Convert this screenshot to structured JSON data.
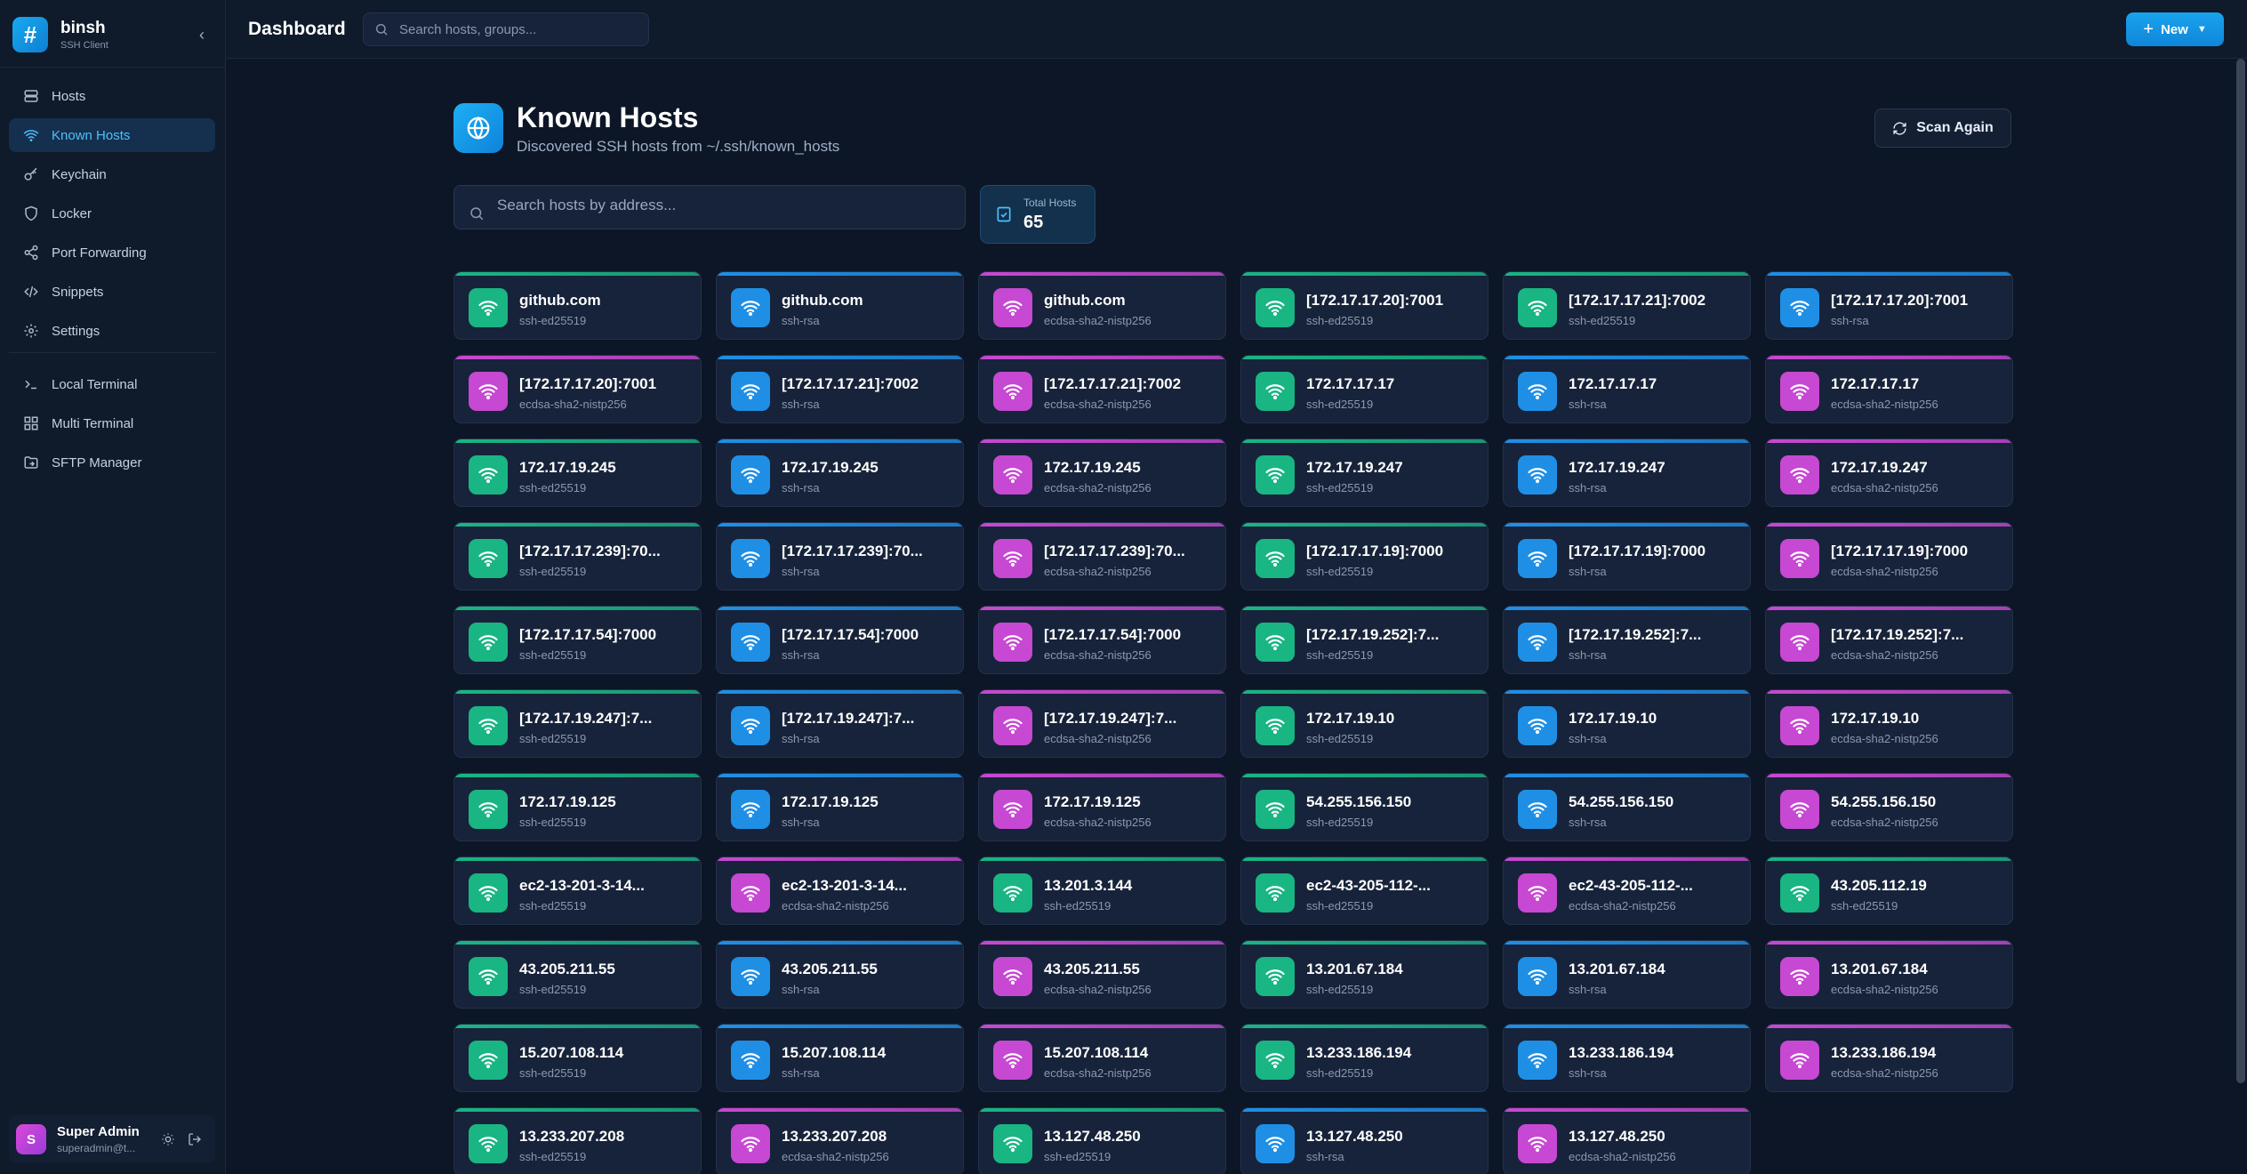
{
  "app": {
    "name": "binsh",
    "subtitle": "SSH Client"
  },
  "colors": {
    "accent": "#1ba3ee",
    "ed25519": "#19b583",
    "rsa": "#1f8fe6",
    "ecdsa": "#c748d2"
  },
  "sidebar": {
    "items": [
      {
        "label": "Hosts",
        "icon": "server-icon"
      },
      {
        "label": "Known Hosts",
        "icon": "wifi-icon",
        "active": true
      },
      {
        "label": "Keychain",
        "icon": "key-icon"
      },
      {
        "label": "Locker",
        "icon": "shield-icon"
      },
      {
        "label": "Port Forwarding",
        "icon": "share-icon"
      },
      {
        "label": "Snippets",
        "icon": "code-icon"
      },
      {
        "label": "Settings",
        "icon": "gear-icon"
      }
    ],
    "tools": [
      {
        "label": "Local Terminal",
        "icon": "terminal-icon"
      },
      {
        "label": "Multi Terminal",
        "icon": "grid-icon"
      },
      {
        "label": "SFTP Manager",
        "icon": "folder-icon"
      }
    ],
    "user": {
      "initial": "S",
      "name": "Super Admin",
      "email": "superadmin@t..."
    }
  },
  "topbar": {
    "title": "Dashboard",
    "search_placeholder": "Search hosts, groups...",
    "new_label": "New"
  },
  "page": {
    "title": "Known Hosts",
    "subtitle": "Discovered SSH hosts from ~/.ssh/known_hosts",
    "scan_label": "Scan Again",
    "search_placeholder": "Search hosts by address...",
    "total_label": "Total Hosts",
    "total_value": "65"
  },
  "hosts": [
    {
      "address": "github.com",
      "key_type": "ssh-ed25519"
    },
    {
      "address": "github.com",
      "key_type": "ssh-rsa"
    },
    {
      "address": "github.com",
      "key_type": "ecdsa-sha2-nistp256"
    },
    {
      "address": "[172.17.17.20]:7001",
      "key_type": "ssh-ed25519"
    },
    {
      "address": "[172.17.17.21]:7002",
      "key_type": "ssh-ed25519"
    },
    {
      "address": "[172.17.17.20]:7001",
      "key_type": "ssh-rsa"
    },
    {
      "address": "[172.17.17.20]:7001",
      "key_type": "ecdsa-sha2-nistp256"
    },
    {
      "address": "[172.17.17.21]:7002",
      "key_type": "ssh-rsa"
    },
    {
      "address": "[172.17.17.21]:7002",
      "key_type": "ecdsa-sha2-nistp256"
    },
    {
      "address": "172.17.17.17",
      "key_type": "ssh-ed25519"
    },
    {
      "address": "172.17.17.17",
      "key_type": "ssh-rsa"
    },
    {
      "address": "172.17.17.17",
      "key_type": "ecdsa-sha2-nistp256"
    },
    {
      "address": "172.17.19.245",
      "key_type": "ssh-ed25519"
    },
    {
      "address": "172.17.19.245",
      "key_type": "ssh-rsa"
    },
    {
      "address": "172.17.19.245",
      "key_type": "ecdsa-sha2-nistp256"
    },
    {
      "address": "172.17.19.247",
      "key_type": "ssh-ed25519"
    },
    {
      "address": "172.17.19.247",
      "key_type": "ssh-rsa"
    },
    {
      "address": "172.17.19.247",
      "key_type": "ecdsa-sha2-nistp256"
    },
    {
      "address": "[172.17.17.239]:70...",
      "key_type": "ssh-ed25519"
    },
    {
      "address": "[172.17.17.239]:70...",
      "key_type": "ssh-rsa"
    },
    {
      "address": "[172.17.17.239]:70...",
      "key_type": "ecdsa-sha2-nistp256"
    },
    {
      "address": "[172.17.17.19]:7000",
      "key_type": "ssh-ed25519"
    },
    {
      "address": "[172.17.17.19]:7000",
      "key_type": "ssh-rsa"
    },
    {
      "address": "[172.17.17.19]:7000",
      "key_type": "ecdsa-sha2-nistp256"
    },
    {
      "address": "[172.17.17.54]:7000",
      "key_type": "ssh-ed25519"
    },
    {
      "address": "[172.17.17.54]:7000",
      "key_type": "ssh-rsa"
    },
    {
      "address": "[172.17.17.54]:7000",
      "key_type": "ecdsa-sha2-nistp256"
    },
    {
      "address": "[172.17.19.252]:7...",
      "key_type": "ssh-ed25519"
    },
    {
      "address": "[172.17.19.252]:7...",
      "key_type": "ssh-rsa"
    },
    {
      "address": "[172.17.19.252]:7...",
      "key_type": "ecdsa-sha2-nistp256"
    },
    {
      "address": "[172.17.19.247]:7...",
      "key_type": "ssh-ed25519"
    },
    {
      "address": "[172.17.19.247]:7...",
      "key_type": "ssh-rsa"
    },
    {
      "address": "[172.17.19.247]:7...",
      "key_type": "ecdsa-sha2-nistp256"
    },
    {
      "address": "172.17.19.10",
      "key_type": "ssh-ed25519"
    },
    {
      "address": "172.17.19.10",
      "key_type": "ssh-rsa"
    },
    {
      "address": "172.17.19.10",
      "key_type": "ecdsa-sha2-nistp256"
    },
    {
      "address": "172.17.19.125",
      "key_type": "ssh-ed25519"
    },
    {
      "address": "172.17.19.125",
      "key_type": "ssh-rsa"
    },
    {
      "address": "172.17.19.125",
      "key_type": "ecdsa-sha2-nistp256"
    },
    {
      "address": "54.255.156.150",
      "key_type": "ssh-ed25519"
    },
    {
      "address": "54.255.156.150",
      "key_type": "ssh-rsa"
    },
    {
      "address": "54.255.156.150",
      "key_type": "ecdsa-sha2-nistp256"
    },
    {
      "address": "ec2-13-201-3-14...",
      "key_type": "ssh-ed25519"
    },
    {
      "address": "ec2-13-201-3-14...",
      "key_type": "ecdsa-sha2-nistp256"
    },
    {
      "address": "13.201.3.144",
      "key_type": "ssh-ed25519"
    },
    {
      "address": "ec2-43-205-112-...",
      "key_type": "ssh-ed25519"
    },
    {
      "address": "ec2-43-205-112-...",
      "key_type": "ecdsa-sha2-nistp256"
    },
    {
      "address": "43.205.112.19",
      "key_type": "ssh-ed25519"
    },
    {
      "address": "43.205.211.55",
      "key_type": "ssh-ed25519"
    },
    {
      "address": "43.205.211.55",
      "key_type": "ssh-rsa"
    },
    {
      "address": "43.205.211.55",
      "key_type": "ecdsa-sha2-nistp256"
    },
    {
      "address": "13.201.67.184",
      "key_type": "ssh-ed25519"
    },
    {
      "address": "13.201.67.184",
      "key_type": "ssh-rsa"
    },
    {
      "address": "13.201.67.184",
      "key_type": "ecdsa-sha2-nistp256"
    },
    {
      "address": "15.207.108.114",
      "key_type": "ssh-ed25519"
    },
    {
      "address": "15.207.108.114",
      "key_type": "ssh-rsa"
    },
    {
      "address": "15.207.108.114",
      "key_type": "ecdsa-sha2-nistp256"
    },
    {
      "address": "13.233.186.194",
      "key_type": "ssh-ed25519"
    },
    {
      "address": "13.233.186.194",
      "key_type": "ssh-rsa"
    },
    {
      "address": "13.233.186.194",
      "key_type": "ecdsa-sha2-nistp256"
    },
    {
      "address": "13.233.207.208",
      "key_type": "ssh-ed25519"
    },
    {
      "address": "13.233.207.208",
      "key_type": "ecdsa-sha2-nistp256"
    },
    {
      "address": "13.127.48.250",
      "key_type": "ssh-ed25519"
    },
    {
      "address": "13.127.48.250",
      "key_type": "ssh-rsa"
    },
    {
      "address": "13.127.48.250",
      "key_type": "ecdsa-sha2-nistp256"
    }
  ]
}
